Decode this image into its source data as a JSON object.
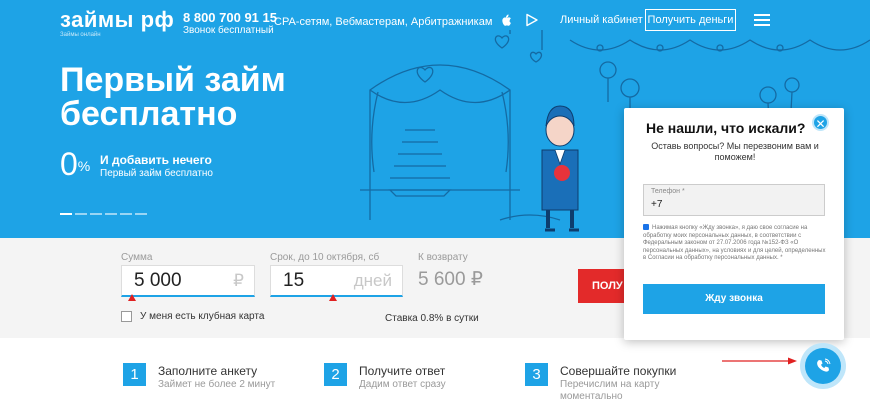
{
  "header": {
    "logo": "займы рф",
    "logo_sub": "Займы онлайн",
    "phone": "8 800 700 91 15",
    "phone_sub": "Звонок бесплатный",
    "partners": "CPA-сетям, Вебмастерам, Арбитражникам",
    "store_icons": [
      "apple-icon",
      "play-store-icon"
    ],
    "cabinet": "Личный кабинет",
    "get_money": "Получить деньги",
    "menu_icon": "hamburger-menu-icon"
  },
  "hero": {
    "title": "Первый займ бесплатно",
    "percent": "0",
    "percent_sign": "%",
    "promo_line1": "И добавить нечего",
    "promo_line2": "Первый займ бесплатно",
    "slides": 6,
    "active_slide": 1
  },
  "calculator": {
    "amount_label": "Сумма",
    "amount_value": "5 000",
    "amount_unit": "₽",
    "term_label": "Срок, до 10 октября, сб",
    "term_value": "15",
    "term_unit": "дней",
    "refund_label": "К возврату",
    "refund_value": "5 600 ₽",
    "submit_partial": "ПОЛУ",
    "club_card": "У меня есть клубная карта",
    "rate": "Ставка 0.8% в сутки"
  },
  "steps": [
    {
      "num": "1",
      "title": "Заполните анкету",
      "sub": "Займет не более 2 минут"
    },
    {
      "num": "2",
      "title": "Получите ответ",
      "sub": "Дадим ответ сразу"
    },
    {
      "num": "3",
      "title": "Совершайте покупки",
      "sub": "Перечислим на карту моментально"
    }
  ],
  "popup": {
    "title": "Не нашли, что искали?",
    "close_icon": "close-icon",
    "text": "Оставь вопросы? Мы перезвоним вам и поможем!",
    "phone_label": "Телефон *",
    "phone_value": "+7",
    "consent": "Нажимая кнопку «Жду звонка», я даю свое согласие на обработку моих персональных данных, в соответствии с Федеральным законом от 27.07.2006 года №152-ФЗ «О персональных данных», на условиях и для целей, определенных в Согласии на обработку персональных данных. *",
    "call_button": "Жду звонка"
  },
  "colors": {
    "brand": "#1ea3e6",
    "accent_red": "#e32a2a"
  }
}
